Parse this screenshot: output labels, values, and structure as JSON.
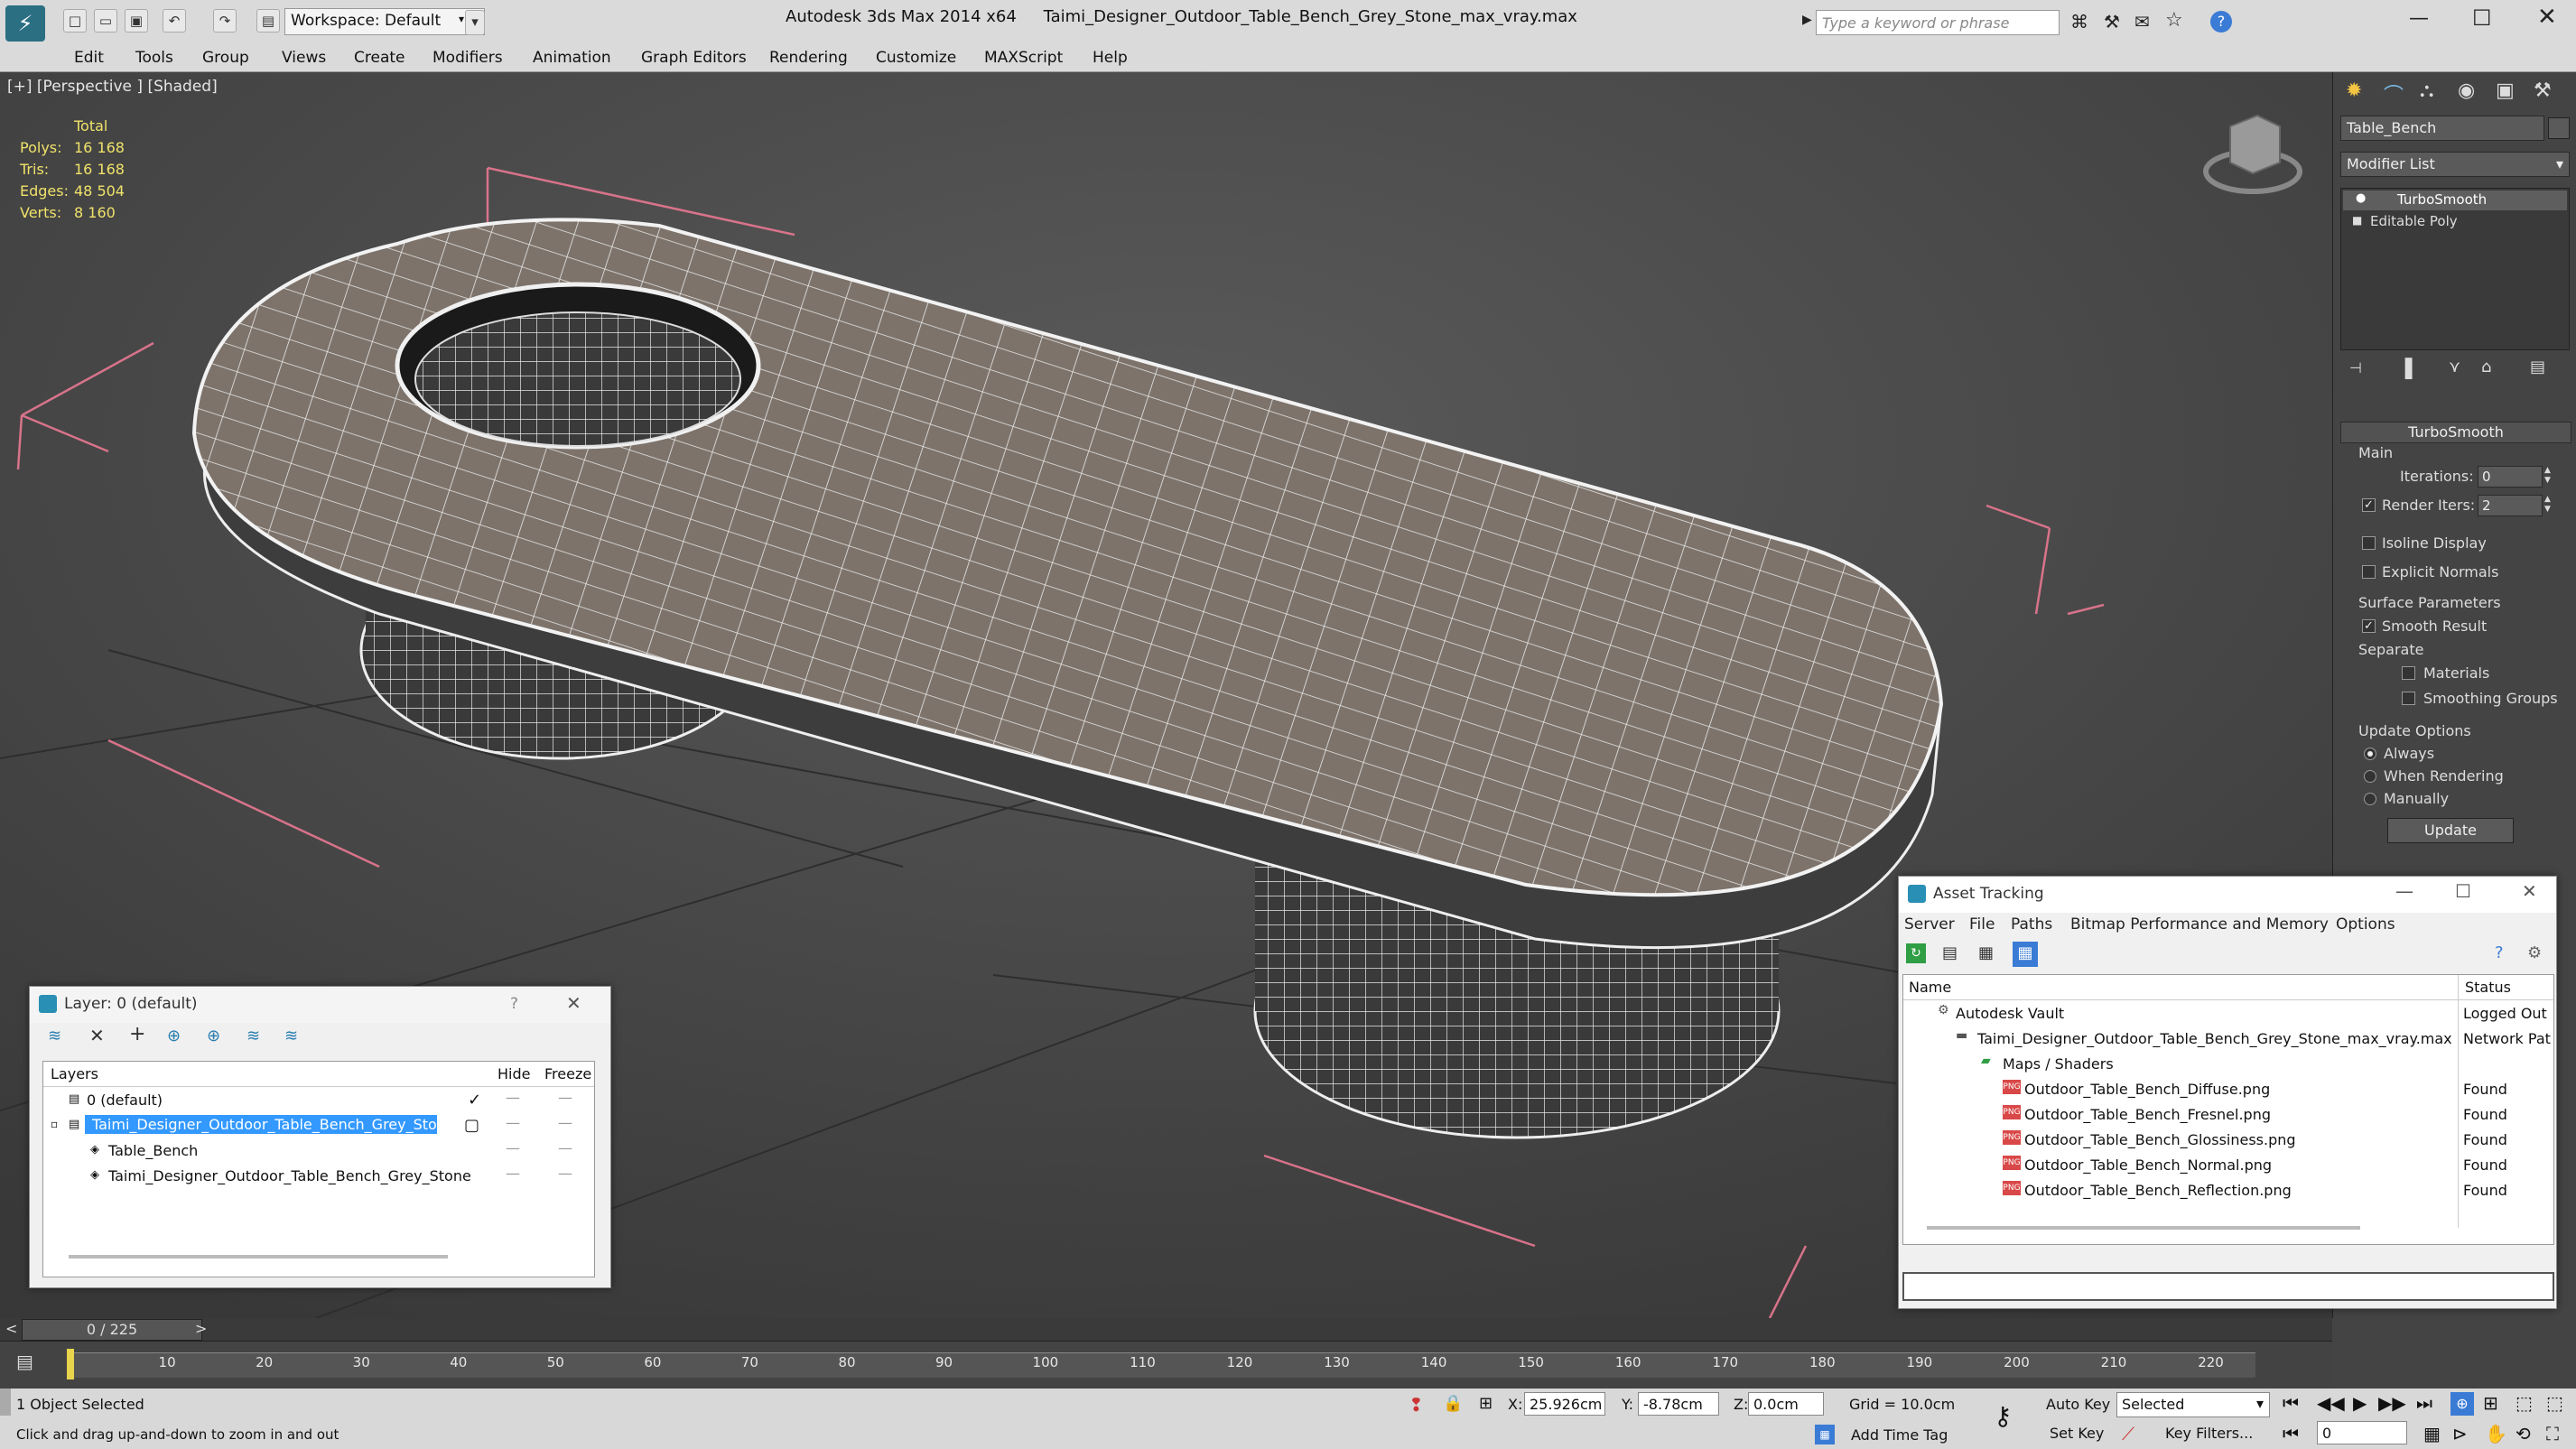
{
  "app": {
    "title": "Autodesk 3ds Max  2014 x64",
    "file_name": "Taimi_Designer_Outdoor_Table_Bench_Grey_Stone_max_vray.max",
    "workspace": "Workspace: Default",
    "search_placeholder": "Type a keyword or phrase"
  },
  "menu": [
    "Edit",
    "Tools",
    "Group",
    "Views",
    "Create",
    "Modifiers",
    "Animation",
    "Graph Editors",
    "Rendering",
    "Customize",
    "MAXScript",
    "Help"
  ],
  "viewport": {
    "label": "[+] [Perspective ] [Shaded]",
    "stats": {
      "header": "Total",
      "rows": [
        {
          "label": "Polys:",
          "value": "16 168"
        },
        {
          "label": "Tris:",
          "value": "16 168"
        },
        {
          "label": "Edges:",
          "value": "48 504"
        },
        {
          "label": "Verts:",
          "value": "8 160"
        }
      ]
    }
  },
  "command_panel": {
    "object_name": "Table_Bench",
    "modifier_list": "Modifier List",
    "stack": [
      "TurboSmooth",
      "Editable Poly"
    ],
    "rollout_title": "TurboSmooth",
    "main_label": "Main",
    "iterations_label": "Iterations:",
    "iterations_value": "0",
    "render_iters_label": "Render Iters:",
    "render_iters_value": "2",
    "isoline_display": "Isoline Display",
    "explicit_normals": "Explicit Normals",
    "surface_params": "Surface Parameters",
    "smooth_result": "Smooth Result",
    "separate": "Separate",
    "materials": "Materials",
    "smoothing_groups": "Smoothing Groups",
    "update_options": "Update Options",
    "always": "Always",
    "when_rendering": "When Rendering",
    "manually": "Manually",
    "update_button": "Update"
  },
  "layer_window": {
    "title": "Layer: 0 (default)",
    "help": "?",
    "columns": {
      "layers": "Layers",
      "hide": "Hide",
      "freeze": "Freeze"
    },
    "rows": [
      {
        "name": "0 (default)"
      },
      {
        "name": "Taimi_Designer_Outdoor_Table_Bench_Grey_Stone"
      },
      {
        "name": "Table_Bench"
      },
      {
        "name": "Taimi_Designer_Outdoor_Table_Bench_Grey_Stone"
      }
    ]
  },
  "asset_window": {
    "title": "Asset Tracking",
    "menu": [
      "Server",
      "File",
      "Paths",
      "Bitmap Performance and Memory",
      "Options"
    ],
    "columns": {
      "name": "Name",
      "status": "Status"
    },
    "rows": [
      {
        "name": "Autodesk Vault",
        "status": "Logged Out"
      },
      {
        "name": "Taimi_Designer_Outdoor_Table_Bench_Grey_Stone_max_vray.max",
        "status": "Network Pat"
      },
      {
        "name": "Maps / Shaders",
        "status": ""
      },
      {
        "name": "Outdoor_Table_Bench_Diffuse.png",
        "status": "Found"
      },
      {
        "name": "Outdoor_Table_Bench_Fresnel.png",
        "status": "Found"
      },
      {
        "name": "Outdoor_Table_Bench_Glossiness.png",
        "status": "Found"
      },
      {
        "name": "Outdoor_Table_Bench_Normal.png",
        "status": "Found"
      },
      {
        "name": "Outdoor_Table_Bench_Reflection.png",
        "status": "Found"
      }
    ]
  },
  "timeline": {
    "frame_indicator": "0 / 225",
    "ticks": [
      "10",
      "20",
      "30",
      "40",
      "50",
      "60",
      "70",
      "80",
      "90",
      "100",
      "110",
      "120",
      "130",
      "140",
      "150",
      "160",
      "170",
      "180",
      "190",
      "200",
      "210",
      "220"
    ]
  },
  "status": {
    "selection": "1 Object Selected",
    "prompt": "Click and drag up-and-down to zoom in and out",
    "x_label": "X:",
    "x_value": "25.926cm",
    "y_label": "Y:",
    "y_value": "-8.78cm",
    "z_label": "Z:",
    "z_value": "0.0cm",
    "grid": "Grid = 10.0cm",
    "add_time_tag": "Add Time Tag",
    "auto_key": "Auto Key",
    "set_key": "Set Key",
    "selected": "Selected",
    "key_filters": "Key Filters...",
    "frame_field": "0"
  }
}
